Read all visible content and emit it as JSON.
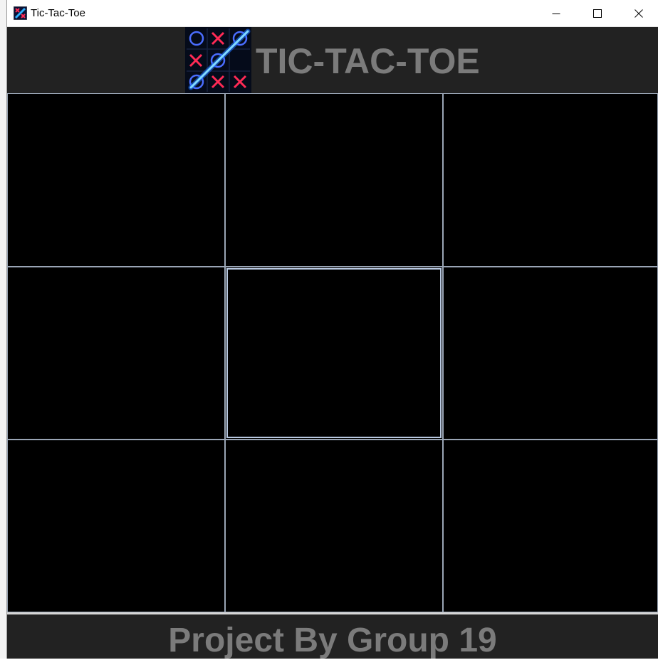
{
  "window": {
    "title": "Tic-Tac-Toe",
    "icon": "tic-tac-toe-app-icon"
  },
  "window_controls": {
    "minimize_icon": "minimize-icon",
    "maximize_icon": "maximize-icon",
    "close_icon": "close-icon"
  },
  "header": {
    "logo_icon": "tic-tac-toe-logo-icon",
    "title": "TIC-TAC-TOE"
  },
  "board": {
    "cells": [
      "",
      "",
      "",
      "",
      "",
      "",
      "",
      "",
      ""
    ],
    "selected_cell": 4
  },
  "footer": {
    "text": "Project By Group 19"
  },
  "colors": {
    "background": "#222222",
    "board": "#000000",
    "cell_border": "#9aa5b5",
    "title_text": "#7b7b7b",
    "logo_o": "#4a6dff",
    "logo_x": "#ff2a55",
    "logo_line": "#2fb2ff"
  }
}
